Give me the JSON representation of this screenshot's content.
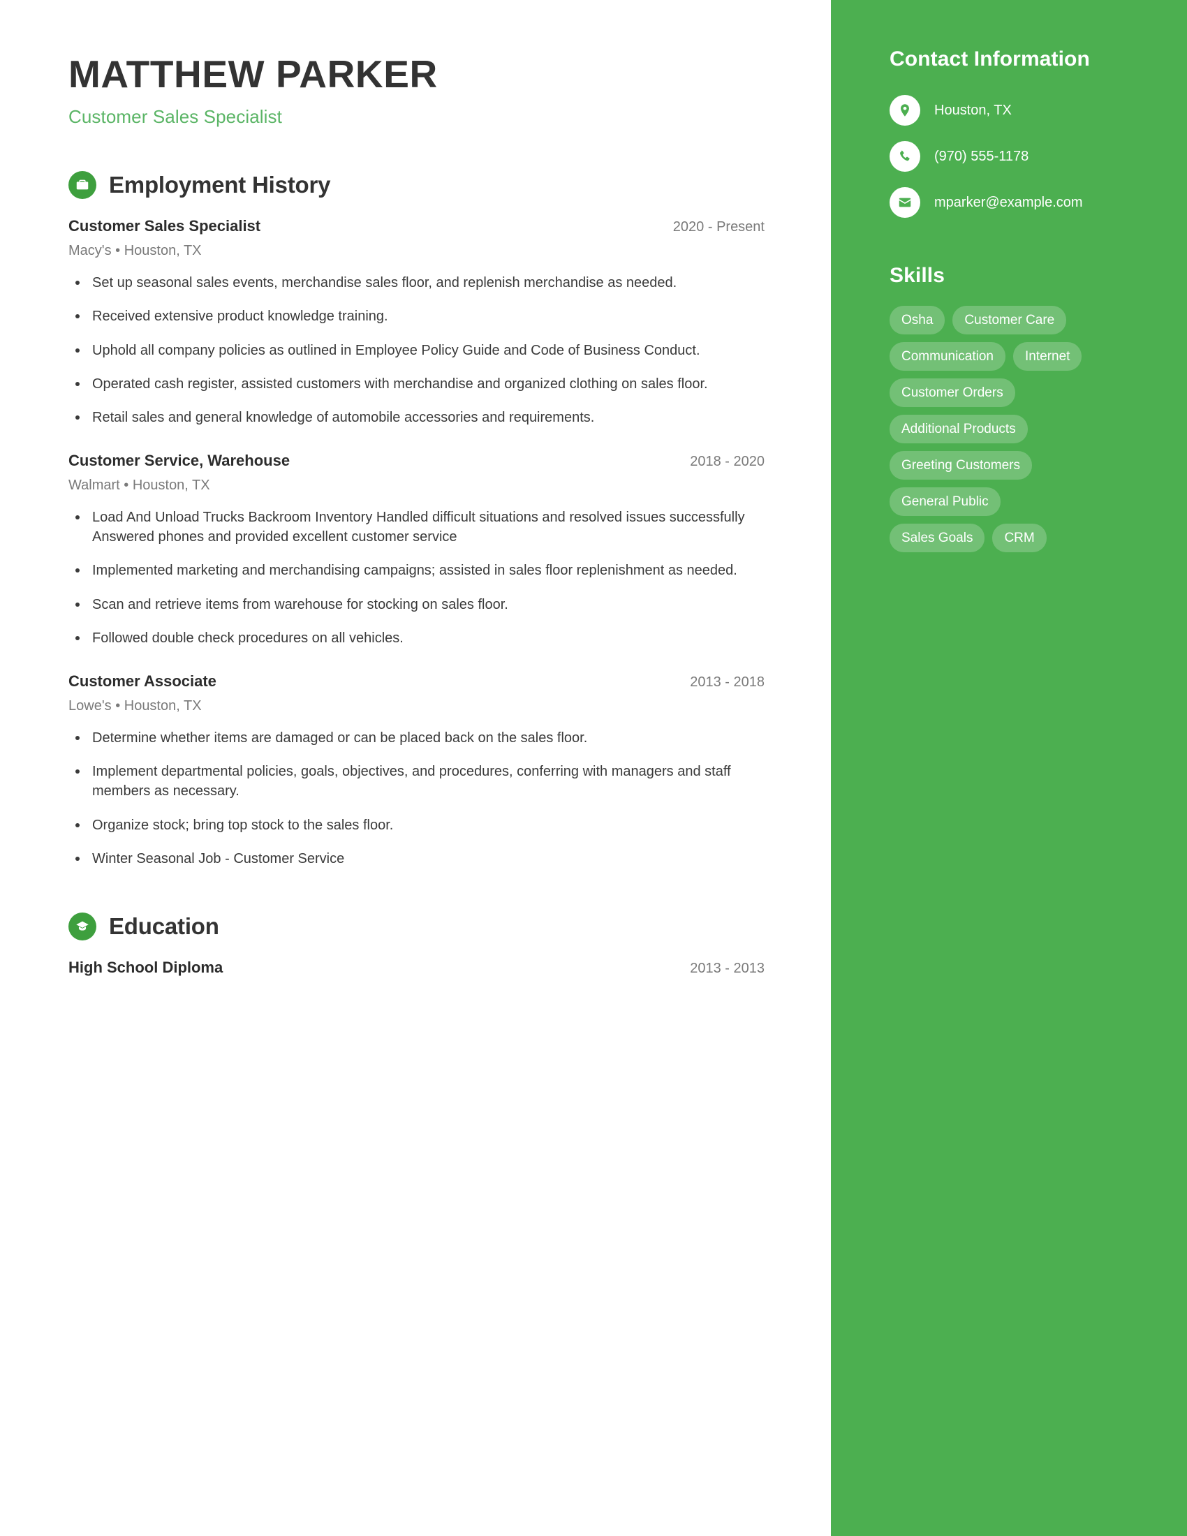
{
  "header": {
    "name": "MATTHEW PARKER",
    "title": "Customer Sales Specialist"
  },
  "colors": {
    "sidebar_background": "#4CAF50",
    "accent_green": "#5BB566",
    "icon_circle": "#3E9F3E",
    "name_color": "#333333",
    "body_text": "#3a3a3a",
    "muted_text": "#7a7a7a",
    "pill_background": "rgba(255,255,255,0.22)"
  },
  "sidebar": {
    "contact_heading": "Contact Information",
    "contact_items": [
      {
        "icon": "map-pin-icon",
        "value": "Houston, TX"
      },
      {
        "icon": "phone-icon",
        "value": "(970) 555-1178"
      },
      {
        "icon": "envelope-icon",
        "value": "mparker@example.com"
      }
    ],
    "skills_heading": "Skills",
    "skills": [
      "Osha",
      "Customer Care",
      "Communication",
      "Internet",
      "Customer Orders",
      "Additional Products",
      "Greeting Customers",
      "General Public",
      "Sales Goals",
      "CRM"
    ]
  },
  "sections": {
    "employment": {
      "icon": "briefcase-icon",
      "title": "Employment History",
      "entries": [
        {
          "title": "Customer Sales Specialist",
          "dates": "2020 - Present",
          "meta": "Macy's  •  Houston, TX",
          "bullets": [
            "Set up seasonal sales events, merchandise sales floor, and replenish merchandise as needed.",
            "Received extensive product knowledge training.",
            "Uphold all company policies as outlined in Employee Policy Guide and Code of Business Conduct.",
            "Operated cash register, assisted customers with merchandise and organized clothing on sales floor.",
            "Retail sales and general knowledge of automobile accessories and requirements."
          ]
        },
        {
          "title": "Customer Service, Warehouse",
          "dates": "2018 - 2020",
          "meta": "Walmart  •  Houston, TX",
          "bullets": [
            "Load And Unload Trucks Backroom Inventory Handled difficult situations and resolved issues successfully Answered phones and provided excellent customer service",
            "Implemented marketing and merchandising campaigns; assisted in sales floor replenishment as needed.",
            "Scan and retrieve items from warehouse for stocking on sales floor.",
            "Followed double check procedures on all vehicles."
          ]
        },
        {
          "title": "Customer Associate",
          "dates": "2013 - 2018",
          "meta": "Lowe's  •  Houston, TX",
          "bullets": [
            "Determine whether items are damaged or can be placed back on the sales floor.",
            "Implement departmental policies, goals, objectives, and procedures, conferring with managers and staff members as necessary.",
            "Organize stock; bring top stock to the sales floor.",
            "Winter Seasonal Job - Customer Service"
          ]
        }
      ]
    },
    "education": {
      "icon": "graduation-cap-icon",
      "title": "Education",
      "entries": [
        {
          "title": "High School Diploma",
          "dates": "2013 - 2013"
        }
      ]
    }
  }
}
